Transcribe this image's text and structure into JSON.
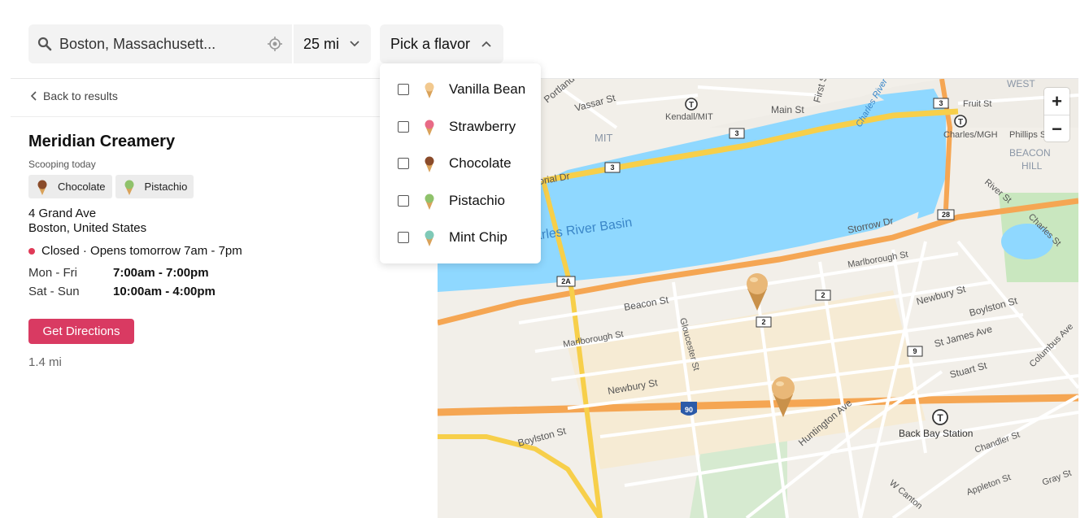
{
  "search": {
    "location": "Boston, Massachusett...",
    "radius": "25 mi",
    "flavor_button": "Pick a flavor"
  },
  "flavors": [
    {
      "label": "Vanilla Bean",
      "color": "#f2c98f",
      "checked": false
    },
    {
      "label": "Strawberry",
      "color": "#e86a86",
      "checked": false
    },
    {
      "label": "Chocolate",
      "color": "#8a4b2a",
      "checked": false
    },
    {
      "label": "Pistachio",
      "color": "#8fc26b",
      "checked": false
    },
    {
      "label": "Mint Chip",
      "color": "#7fc9b7",
      "checked": false
    }
  ],
  "detail": {
    "back_label": "Back to results",
    "name": "Meridian Creamery",
    "scooping_label": "Scooping today",
    "chips": [
      {
        "label": "Chocolate",
        "color": "#8a4b2a"
      },
      {
        "label": "Pistachio",
        "color": "#8fc26b"
      }
    ],
    "address_line1": "4 Grand Ave",
    "address_line2": "Boston, United States",
    "status": "Closed · Opens tomorrow 7am - 7pm",
    "hours": [
      {
        "days": "Mon - Fri",
        "time": "7:00am - 7:00pm"
      },
      {
        "days": "Sat - Sun",
        "time": "10:00am - 4:00pm"
      }
    ],
    "directions_button": "Get Directions",
    "distance": "1.4 mi"
  },
  "map": {
    "zoom_in": "+",
    "zoom_out": "−",
    "labels": {
      "west": "WEST",
      "mit": "MIT",
      "kendall": "Kendall/MIT",
      "main_st": "Main St",
      "vassar_st": "Vassar St",
      "portland": "Portland",
      "first_st": "First St",
      "fruit_st": "Fruit St",
      "charles_mgh": "Charles/MGH",
      "phillips_st": "Phillips St",
      "beacon": "BEACON",
      "hill": "HILL",
      "charles_river": "Charles River",
      "memorial_dr": "orial Dr",
      "basin": "arles River Basin",
      "storrow": "Storrow Dr",
      "river_st": "River St",
      "charles_st": "Charles St",
      "marlborough_1": "Marlborough St",
      "marlborough_2": "Marlborough St",
      "beacon_st": "Beacon St",
      "newbury_1": "Newbury St",
      "newbury_2": "Newbury St",
      "boylston_1": "Boylston St",
      "boylston_2": "Boylston St",
      "gloucester": "Gloucester St",
      "st_james": "St James Ave",
      "stuart": "Stuart St",
      "columbus": "Columbus Ave",
      "huntington": "Huntington Ave",
      "back_bay": "Back Bay Station",
      "chandler": "Chandler St",
      "appleton": "Appleton St",
      "gray": "Gray St",
      "w_canton": "W Canton",
      "shield_3a": "3",
      "shield_3b": "3",
      "shield_3c": "3",
      "shield_28": "28",
      "shield_2a": "2A",
      "shield_2a2": "2",
      "shield_2b": "2",
      "shield_9": "9",
      "shield_90": "90"
    }
  }
}
